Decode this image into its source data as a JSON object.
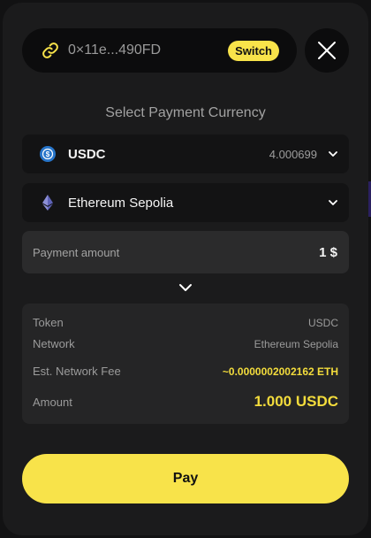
{
  "wallet": {
    "address": "0×11e...490FD",
    "switch_label": "Switch"
  },
  "title": "Select Payment Currency",
  "currency": {
    "symbol": "USDC",
    "balance": "4.000699"
  },
  "network": {
    "name": "Ethereum Sepolia"
  },
  "payment": {
    "label": "Payment amount",
    "value": "1 $"
  },
  "summary": {
    "token_label": "Token",
    "token_value": "USDC",
    "network_label": "Network",
    "network_value": "Ethereum Sepolia",
    "fee_label": "Est. Network Fee",
    "fee_value": "~0.0000002002162 ETH",
    "amount_label": "Amount",
    "amount_value": "1.000 USDC"
  },
  "pay_label": "Pay",
  "colors": {
    "accent": "#f8e34a",
    "modal_bg": "#1b1b1c",
    "usdc_blue": "#2775ca"
  },
  "icons": {
    "link": "link-icon",
    "close": "close-icon",
    "usdc": "usdc-coin-icon",
    "ethereum": "ethereum-icon",
    "chevron": "chevron-down-icon"
  }
}
